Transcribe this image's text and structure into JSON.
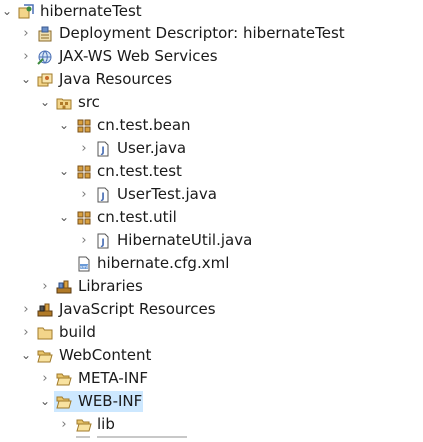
{
  "tree": {
    "project": {
      "label": "hibernateTest",
      "icon": "project-icon",
      "expanded": true
    },
    "deployment_descriptor": {
      "label": "Deployment Descriptor: hibernateTest",
      "icon": "deployment-descriptor-icon",
      "expanded": false
    },
    "jaxws": {
      "label": "JAX-WS Web Services",
      "icon": "web-services-icon",
      "expanded": false
    },
    "java_resources": {
      "label": "Java Resources",
      "icon": "java-resources-icon",
      "expanded": true
    },
    "src": {
      "label": "src",
      "icon": "source-folder-icon",
      "expanded": true
    },
    "pkg_bean": {
      "label": "cn.test.bean",
      "icon": "package-icon",
      "expanded": true
    },
    "user_java": {
      "label": "User.java",
      "icon": "java-file-icon",
      "expanded": false
    },
    "pkg_test": {
      "label": "cn.test.test",
      "icon": "package-icon",
      "expanded": true
    },
    "usertest_java": {
      "label": "UserTest.java",
      "icon": "java-file-icon",
      "expanded": false
    },
    "pkg_util": {
      "label": "cn.test.util",
      "icon": "package-icon",
      "expanded": true
    },
    "hibernateutil_java": {
      "label": "HibernateUtil.java",
      "icon": "java-file-icon",
      "expanded": false
    },
    "hibernate_cfg": {
      "label": "hibernate.cfg.xml",
      "icon": "xml-file-icon"
    },
    "libraries": {
      "label": "Libraries",
      "icon": "libraries-icon",
      "expanded": false
    },
    "js_resources": {
      "label": "JavaScript Resources",
      "icon": "javascript-resources-icon",
      "expanded": false
    },
    "build": {
      "label": "build",
      "icon": "folder-icon",
      "expanded": false
    },
    "webcontent": {
      "label": "WebContent",
      "icon": "folder-open-icon",
      "expanded": true
    },
    "meta_inf": {
      "label": "META-INF",
      "icon": "folder-icon",
      "expanded": false
    },
    "web_inf": {
      "label": "WEB-INF",
      "icon": "folder-open-icon",
      "expanded": true,
      "selected": true
    },
    "lib": {
      "label": "lib",
      "icon": "folder-icon",
      "expanded": false
    }
  },
  "colors": {
    "selection": "#cde8ff",
    "folder": "#e8b84a",
    "package": "#b07a28",
    "java_file": "#4a6fb5",
    "text": "#1a1a1a"
  }
}
